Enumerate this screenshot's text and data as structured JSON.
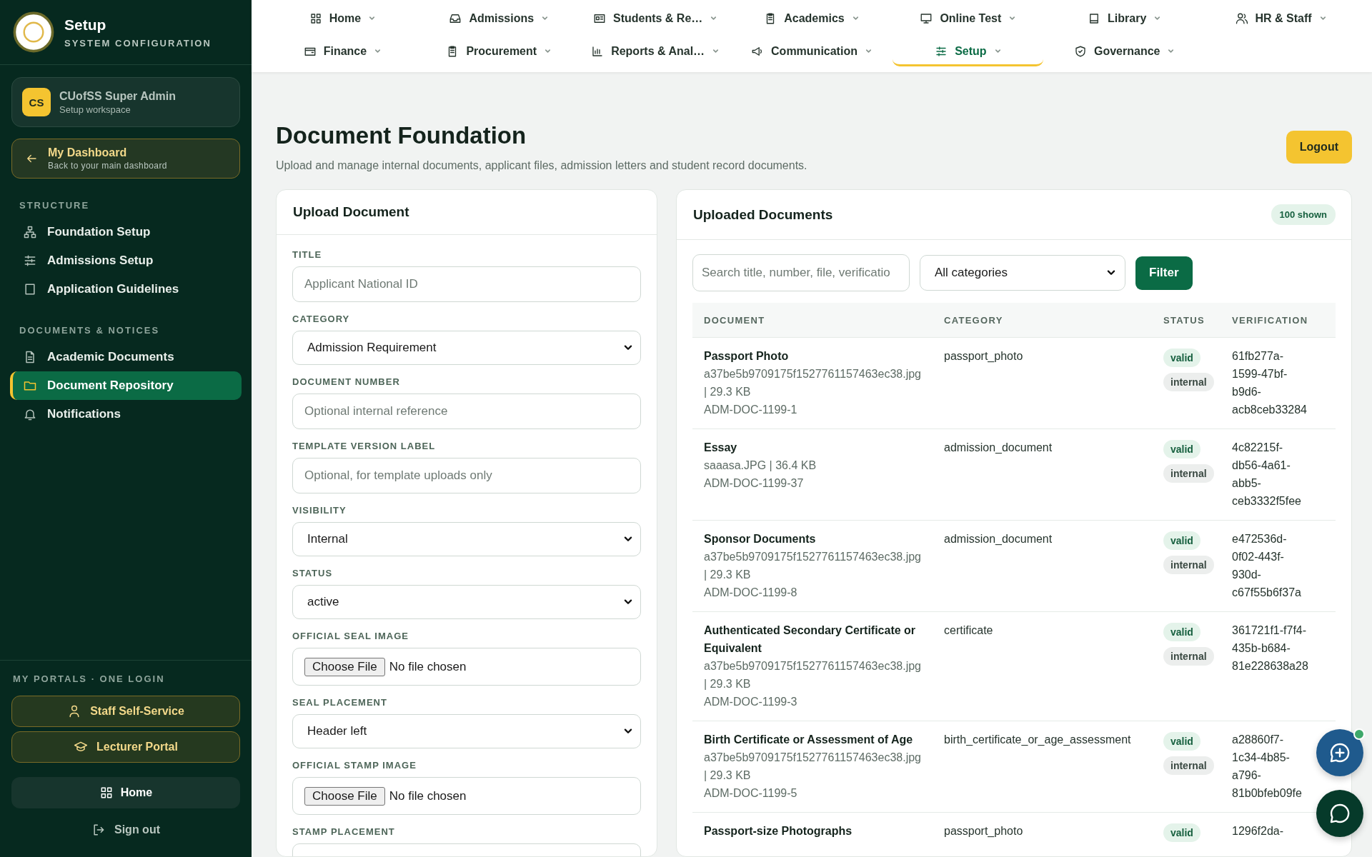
{
  "sidebar": {
    "title": "Setup",
    "subtitle": "SYSTEM CONFIGURATION",
    "user": {
      "initials": "CS",
      "name": "CUofSS Super Admin",
      "role": "Setup workspace"
    },
    "dashboard_link": {
      "label": "My Dashboard",
      "hint": "Back to your main dashboard"
    },
    "sections": [
      {
        "heading": "STRUCTURE",
        "items": [
          {
            "label": "Foundation Setup",
            "selected": false
          },
          {
            "label": "Admissions Setup",
            "selected": false
          },
          {
            "label": "Application Guidelines",
            "selected": false
          }
        ]
      },
      {
        "heading": "DOCUMENTS & NOTICES",
        "items": [
          {
            "label": "Academic Documents",
            "selected": false
          },
          {
            "label": "Document Repository",
            "selected": true
          },
          {
            "label": "Notifications",
            "selected": false
          }
        ]
      }
    ],
    "portals_heading": "MY PORTALS · ONE LOGIN",
    "portals": [
      "Staff Self-Service",
      "Lecturer Portal"
    ],
    "home": "Home",
    "sign_out": "Sign out"
  },
  "nav": [
    {
      "label": "Home",
      "selected": false
    },
    {
      "label": "Admissions",
      "selected": false
    },
    {
      "label": "Students & Re…",
      "selected": false
    },
    {
      "label": "Academics",
      "selected": false
    },
    {
      "label": "Online Test",
      "selected": false
    },
    {
      "label": "Library",
      "selected": false
    },
    {
      "label": "HR & Staff",
      "selected": false
    },
    {
      "label": "Finance",
      "selected": false
    },
    {
      "label": "Procurement",
      "selected": false
    },
    {
      "label": "Reports & Anal…",
      "selected": false
    },
    {
      "label": "Communication",
      "selected": false
    },
    {
      "label": "Setup",
      "selected": true
    },
    {
      "label": "Governance",
      "selected": false
    }
  ],
  "page": {
    "title": "Document Foundation",
    "subtitle": "Upload and manage internal documents, applicant files, admission letters and student record documents.",
    "logout": "Logout"
  },
  "upload_form": {
    "title": "Upload Document",
    "fields": [
      {
        "kind": "text",
        "label": "TITLE",
        "placeholder": "Applicant National ID"
      },
      {
        "kind": "select",
        "label": "CATEGORY",
        "value": "Admission Requirement"
      },
      {
        "kind": "text",
        "label": "DOCUMENT NUMBER",
        "placeholder": "Optional internal reference"
      },
      {
        "kind": "text",
        "label": "TEMPLATE VERSION LABEL",
        "placeholder": "Optional, for template uploads only"
      },
      {
        "kind": "select",
        "label": "VISIBILITY",
        "value": "Internal"
      },
      {
        "kind": "select",
        "label": "STATUS",
        "value": "active"
      },
      {
        "kind": "file",
        "label": "OFFICIAL SEAL IMAGE",
        "button": "Choose File",
        "value": "No file chosen"
      },
      {
        "kind": "select",
        "label": "SEAL PLACEMENT",
        "value": "Header left"
      },
      {
        "kind": "file",
        "label": "OFFICIAL STAMP IMAGE",
        "button": "Choose File",
        "value": "No file chosen"
      },
      {
        "kind": "select",
        "label": "STAMP PLACEMENT"
      }
    ]
  },
  "documents": {
    "title": "Uploaded Documents",
    "count": "100 shown",
    "search": {
      "placeholder": "Search title, number, file, verificatio"
    },
    "category_filter": "All categories",
    "filter_button": "Filter",
    "columns": [
      "DOCUMENT",
      "CATEGORY",
      "STATUS",
      "VERIFICATION"
    ],
    "rows": [
      {
        "title": "Passport Photo",
        "file_info": "a37be5b9709175f1527761157463ec38.jpg | 29.3 KB",
        "number": "ADM-DOC-1199-1",
        "category": "passport_photo",
        "statuses": [
          "valid",
          "internal"
        ],
        "verification": "61fb277a-1599-47bf-b9d6-acb8ceb33284"
      },
      {
        "title": "Essay",
        "file_info": "saaasa.JPG | 36.4 KB",
        "number": "ADM-DOC-1199-37",
        "category": "admission_document",
        "statuses": [
          "valid",
          "internal"
        ],
        "verification": "4c82215f-db56-4a61-abb5-ceb3332f5fee"
      },
      {
        "title": "Sponsor Documents",
        "file_info": "a37be5b9709175f1527761157463ec38.jpg | 29.3 KB",
        "number": "ADM-DOC-1199-8",
        "category": "admission_document",
        "statuses": [
          "valid",
          "internal"
        ],
        "verification": "e472536d-0f02-443f-930d-c67f55b6f37a"
      },
      {
        "title": "Authenticated Secondary Certificate or Equivalent",
        "file_info": "a37be5b9709175f1527761157463ec38.jpg | 29.3 KB",
        "number": "ADM-DOC-1199-3",
        "category": "certificate",
        "statuses": [
          "valid",
          "internal"
        ],
        "verification": "361721f1-f7f4-435b-b684-81e228638a28"
      },
      {
        "title": "Birth Certificate or Assessment of Age",
        "file_info": "a37be5b9709175f1527761157463ec38.jpg | 29.3 KB",
        "number": "ADM-DOC-1199-5",
        "category": "birth_certificate_or_age_assessment",
        "statuses": [
          "valid",
          "internal"
        ],
        "verification": "a28860f7-1c34-4b85-a796-81b0bfeb09fe"
      },
      {
        "title": "Passport-size Photographs",
        "category": "passport_photo",
        "statuses": [
          "valid"
        ],
        "verification": "1296f2da-"
      }
    ]
  }
}
